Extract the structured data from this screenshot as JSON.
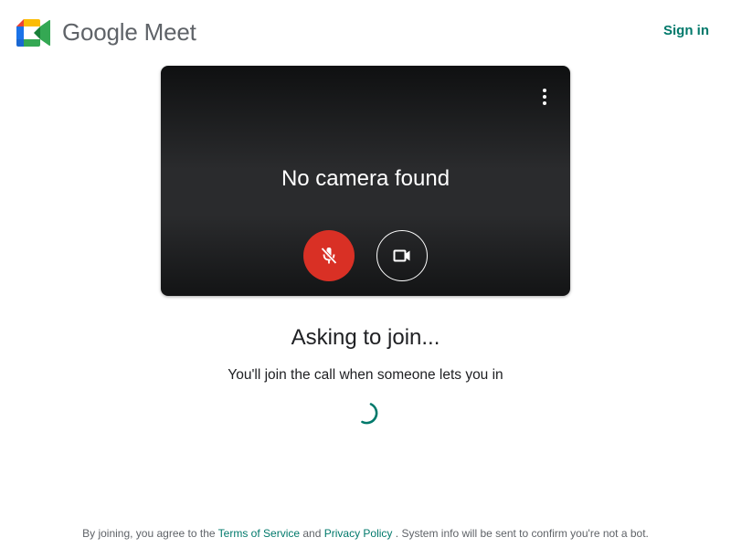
{
  "header": {
    "logo_text": "Google Meet",
    "sign_in_label": "Sign in"
  },
  "preview": {
    "status_text": "No camera found",
    "more_icon": "more-vert-icon",
    "mic_icon": "mic-off-icon",
    "camera_icon": "videocam-icon"
  },
  "main": {
    "title": "Asking to join...",
    "subtitle": "You'll join the call when someone lets you in"
  },
  "footer": {
    "prefix": "By joining, you agree to the",
    "terms_label": "Terms of Service",
    "and_text": "and",
    "privacy_label": "Privacy Policy",
    "suffix": ". System info will be sent to confirm you're not a bot."
  },
  "colors": {
    "accent": "#00796b",
    "mic_off_red": "#d93025",
    "logo_blue": "#1e8e3e"
  }
}
